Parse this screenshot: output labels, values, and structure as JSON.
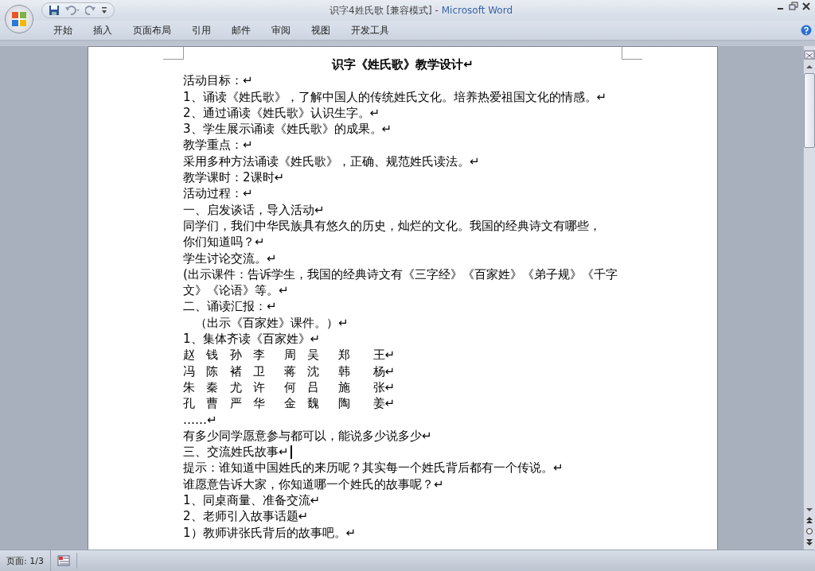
{
  "window": {
    "title": "识字4姓氏歌 [兼容模式] -",
    "app": "Microsoft Word"
  },
  "ribbon_tabs": [
    {
      "label": "开始"
    },
    {
      "label": "插入"
    },
    {
      "label": "页面布局"
    },
    {
      "label": "引用"
    },
    {
      "label": "邮件"
    },
    {
      "label": "审阅"
    },
    {
      "label": "视图"
    },
    {
      "label": "开发工具"
    }
  ],
  "document": {
    "paragraphs": [
      {
        "kind": "title",
        "text": "识字《姓氏歌》教学设计↵"
      },
      {
        "kind": "text",
        "text": "活动目标：↵"
      },
      {
        "kind": "text",
        "text": "1、诵读《姓氏歌》，了解中国人的传统姓氏文化。培养热爱祖国文化的情感。↵"
      },
      {
        "kind": "text",
        "text": "2、通过诵读《姓氏歌》认识生字。↵"
      },
      {
        "kind": "text",
        "text": "3、学生展示诵读《姓氏歌》的成果。↵"
      },
      {
        "kind": "text",
        "text": "教学重点：↵"
      },
      {
        "kind": "text",
        "text": "采用多种方法诵读《姓氏歌》，正确、规范姓氏读法。↵"
      },
      {
        "kind": "text",
        "text": "教学课时：2课时↵"
      },
      {
        "kind": "text",
        "text": "活动过程：↵"
      },
      {
        "kind": "text",
        "text": "一、启发谈话，导入活动↵"
      },
      {
        "kind": "wrapped",
        "lines": [
          "同学们，我们中华民族具有悠久的历史，灿烂的文化。我国的经典诗文有哪些，",
          "你们知道吗？↵"
        ]
      },
      {
        "kind": "text",
        "text": "学生讨论交流。↵"
      },
      {
        "kind": "wrapped",
        "lines": [
          "(出示课件：告诉学生，我国的经典诗文有《三字经》《百家姓》《弟子规》《千字",
          "文》《论语》等。↵"
        ]
      },
      {
        "kind": "text",
        "text": "二、诵读汇报：↵"
      },
      {
        "kind": "indent",
        "text": "（出示《百家姓》课件。）↵"
      },
      {
        "kind": "text",
        "text": "1、集体齐读《百家姓》↵"
      },
      {
        "kind": "names",
        "text": "赵   钱   孙   李     周   吴     郑      王↵"
      },
      {
        "kind": "names",
        "text": "冯   陈   褚   卫     蒋   沈     韩      杨↵"
      },
      {
        "kind": "names",
        "text": "朱   秦   尤   许     何   吕     施      张↵"
      },
      {
        "kind": "names",
        "text": "孔   曹   严   华     金   魏     陶      姜↵"
      },
      {
        "kind": "text",
        "text": "……↵"
      },
      {
        "kind": "text",
        "text": "有多少同学愿意参与都可以，能说多少说多少↵"
      },
      {
        "kind": "text",
        "text": "三、交流姓氏故事↵",
        "cursor": true
      },
      {
        "kind": "text",
        "text": "提示：谁知道中国姓氏的来历呢？其实每一个姓氏背后都有一个传说。↵"
      },
      {
        "kind": "text",
        "text": "谁愿意告诉大家，你知道哪一个姓氏的故事呢？↵"
      },
      {
        "kind": "text",
        "text": "1、同桌商量、准备交流↵"
      },
      {
        "kind": "text",
        "text": "2、老师引入故事话题↵"
      },
      {
        "kind": "text",
        "text": "1）教师讲张氏背后的故事吧。↵"
      }
    ]
  },
  "status_bar": {
    "page": "页面: 1/3"
  }
}
